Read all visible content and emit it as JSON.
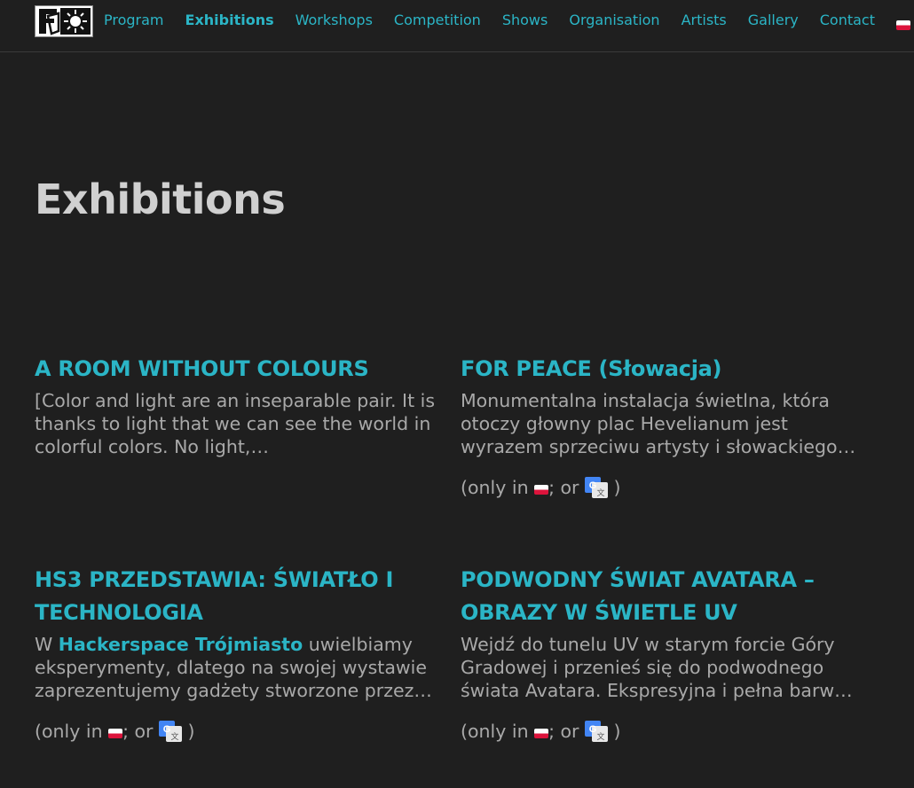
{
  "nav": {
    "items": [
      {
        "label": "Program",
        "active": false
      },
      {
        "label": "Exhibitions",
        "active": true
      },
      {
        "label": "Workshops",
        "active": false
      },
      {
        "label": "Competition",
        "active": false
      },
      {
        "label": "Shows",
        "active": false
      },
      {
        "label": "Organisation",
        "active": false
      },
      {
        "label": "Artists",
        "active": false
      },
      {
        "label": "Gallery",
        "active": false
      },
      {
        "label": "Contact",
        "active": false
      }
    ],
    "language_flag_icon": "poland-flag-icon"
  },
  "page": {
    "title": "Exhibitions"
  },
  "cards": [
    {
      "title": "A ROOM WITHOUT COLOURS",
      "excerpt": "[Color and light are an inseparable pair. It is thanks to light that we can see the world in colorful colors. No light,…"
    },
    {
      "title": "FOR PEACE (Słowacja)",
      "excerpt": "Monumentalna instalacja świetlna, która otoczy głowny plac Hevelianum jest wyrazem sprzeciwu artysty i słowackiego…",
      "lang_note": {
        "prefix": "(only in ",
        "middle": "; or ",
        "suffix": " )"
      }
    },
    {
      "title": "HS3 PRZEDSTAWIA: ŚWIATŁO I TECHNOLOGIA",
      "excerpt_prefix": "W ",
      "excerpt_link": "Hackerspace Trójmiasto",
      "excerpt_rest": " uwielbiamy eksperymenty, dlatego na swojej wystawie zaprezentujemy gadżety stworzone przez…",
      "lang_note": {
        "prefix": "(only in ",
        "middle": "; or ",
        "suffix": " )"
      }
    },
    {
      "title": "PODWODNY ŚWIAT AVATARA – OBRAZY W ŚWIETLE UV",
      "excerpt": "Wejdź do tunelu UV w starym forcie Góry Gradowej i przenieś się do podwodnego świata Avatara. Ekspresyjna i pełna barw…",
      "lang_note": {
        "prefix": "(only in ",
        "middle": "; or ",
        "suffix": " )"
      }
    }
  ],
  "colors": {
    "background": "#1f1f1f",
    "accent": "#2bb5c6",
    "text": "#a9a9a9",
    "heading": "#d0d0d0"
  },
  "icons": {
    "logo": "festival-logo",
    "flag": "poland-flag-icon",
    "translate": "google-translate-icon"
  }
}
